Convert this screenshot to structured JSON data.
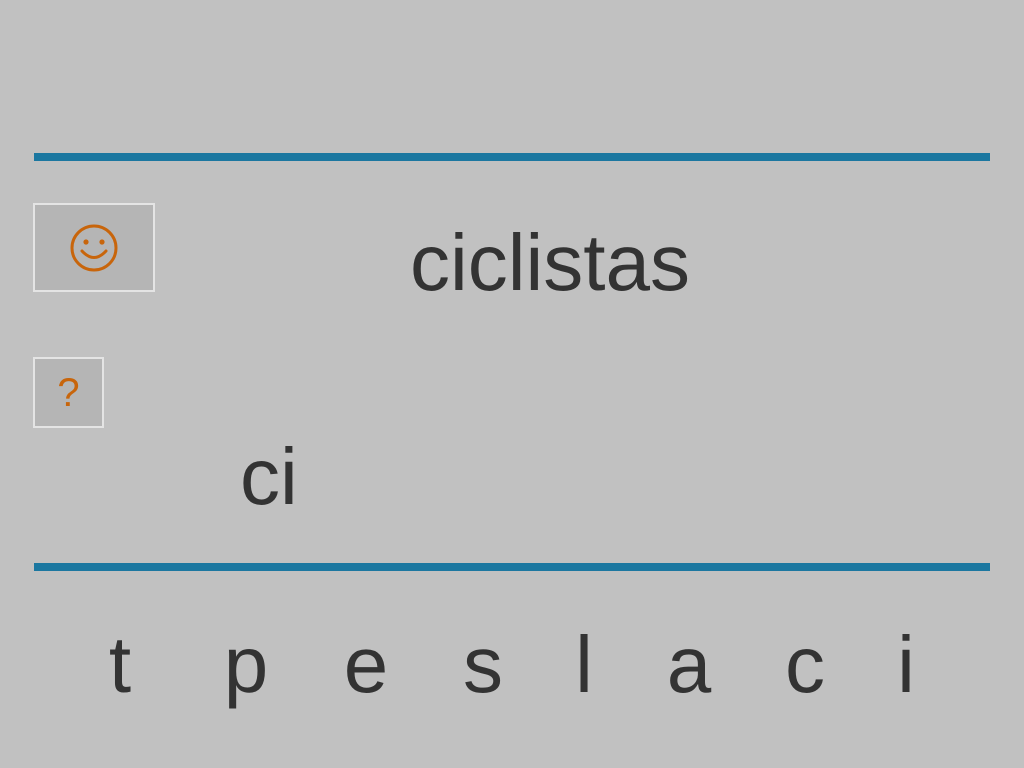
{
  "buttons": {
    "smiley_icon": "smiley-face-icon",
    "help_label": "?"
  },
  "word": {
    "target": "ciclistas",
    "typed": "ci"
  },
  "letters": [
    "t",
    "p",
    "e",
    "s",
    "l",
    "a",
    "c",
    "i"
  ],
  "colors": {
    "background": "#c1c1c1",
    "rule": "#1b77a0",
    "accent": "#c8650b",
    "text": "#333333"
  }
}
